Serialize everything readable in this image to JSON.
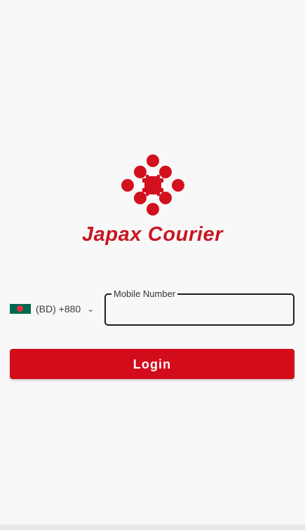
{
  "brand": {
    "name": "Japax Courier",
    "color": "#c81722"
  },
  "phone": {
    "country_code": "(BD) +880",
    "country_flag": "bangladesh-flag-icon",
    "mobile_label": "Mobile Number",
    "mobile_value": ""
  },
  "actions": {
    "login_label": "Login",
    "login_color": "#d30c1c"
  }
}
